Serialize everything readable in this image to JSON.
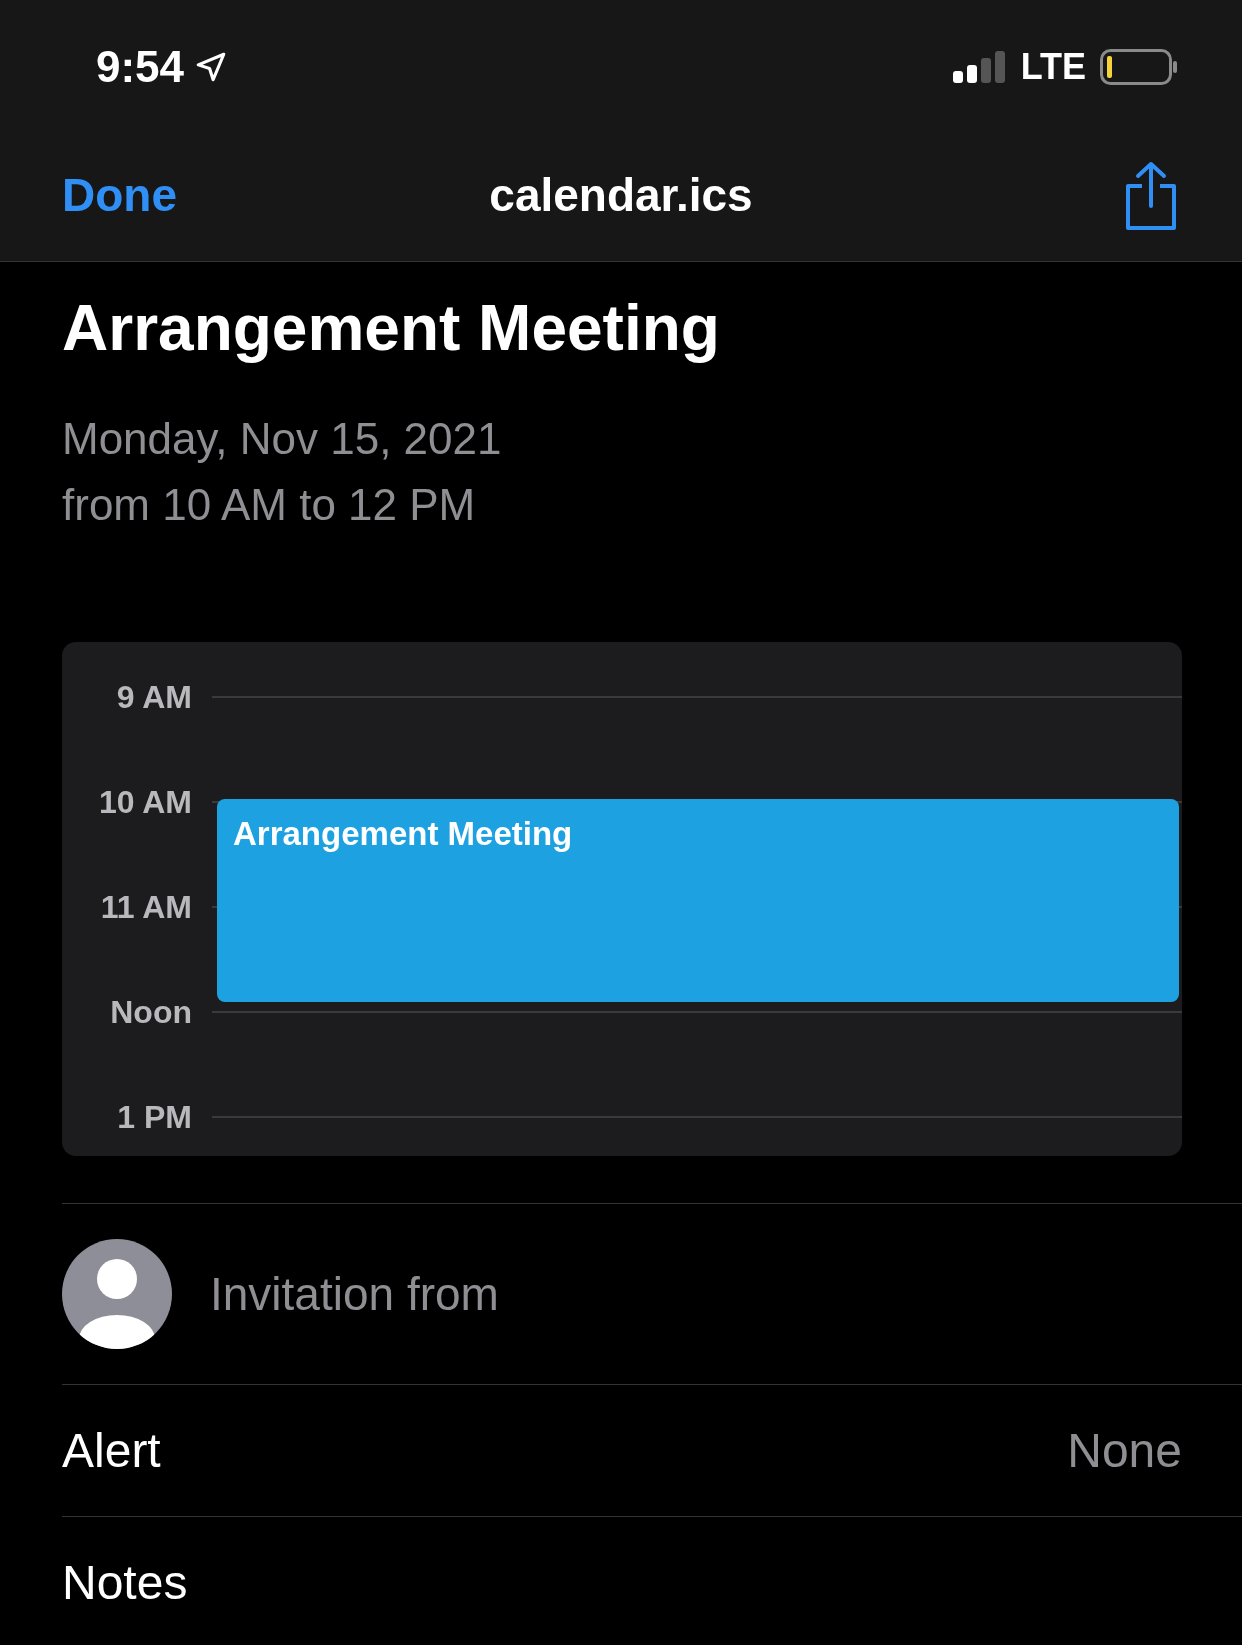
{
  "status_bar": {
    "time": "9:54",
    "network": "LTE"
  },
  "nav_bar": {
    "done": "Done",
    "title": "calendar.ics"
  },
  "event": {
    "title": "Arrangement Meeting",
    "date": "Monday, Nov 15, 2021",
    "time": "from 10 AM to 12 PM"
  },
  "day_view": {
    "hours": [
      "9 AM",
      "10 AM",
      "11 AM",
      "Noon",
      "1 PM"
    ],
    "event_title": "Arrangement Meeting"
  },
  "invitation": {
    "label": "Invitation from"
  },
  "rows": [
    {
      "label": "Alert",
      "value": "None"
    },
    {
      "label": "Notes"
    }
  ]
}
